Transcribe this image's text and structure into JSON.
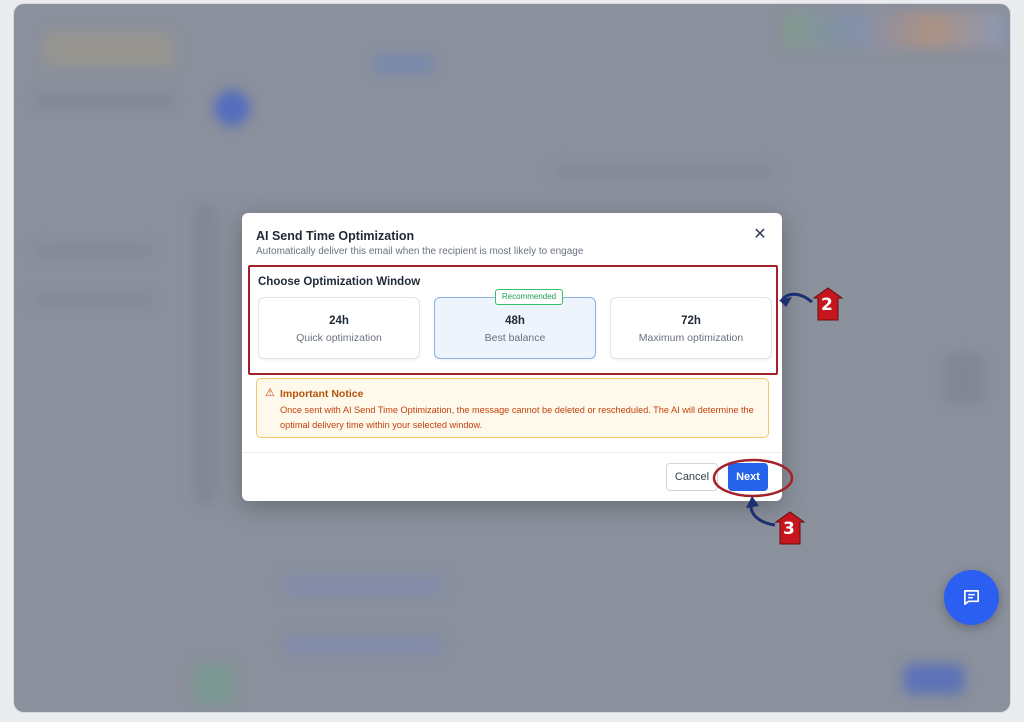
{
  "modal": {
    "title": "AI Send Time Optimization",
    "subtitle": "Automatically deliver this email when the recipient is most likely to engage",
    "close_icon": "close-icon",
    "section_label": "Choose Optimization Window",
    "options": [
      {
        "time": "24h",
        "desc": "Quick optimization",
        "selected": false
      },
      {
        "time": "48h",
        "desc": "Best balance",
        "selected": true,
        "badge": "Recommended"
      },
      {
        "time": "72h",
        "desc": "Maximum optimization",
        "selected": false
      }
    ],
    "notice": {
      "icon": "warning-icon",
      "title": "Important Notice",
      "body": "Once sent with AI Send Time Optimization, the message cannot be deleted or rescheduled. The AI will determine the optimal delivery time within your selected window."
    },
    "cancel_label": "Cancel",
    "next_label": "Next"
  },
  "chat_fab": {
    "icon": "chat-icon"
  },
  "annotations": {
    "step_2": "2",
    "step_3": "3",
    "highlight_color": "#a3222a",
    "arrow_color": "#1c2f6e"
  },
  "colors": {
    "primary": "#2563eb",
    "overlay": "#8a909c",
    "badge_green": "#34c06a",
    "warning": "#c2410c"
  }
}
